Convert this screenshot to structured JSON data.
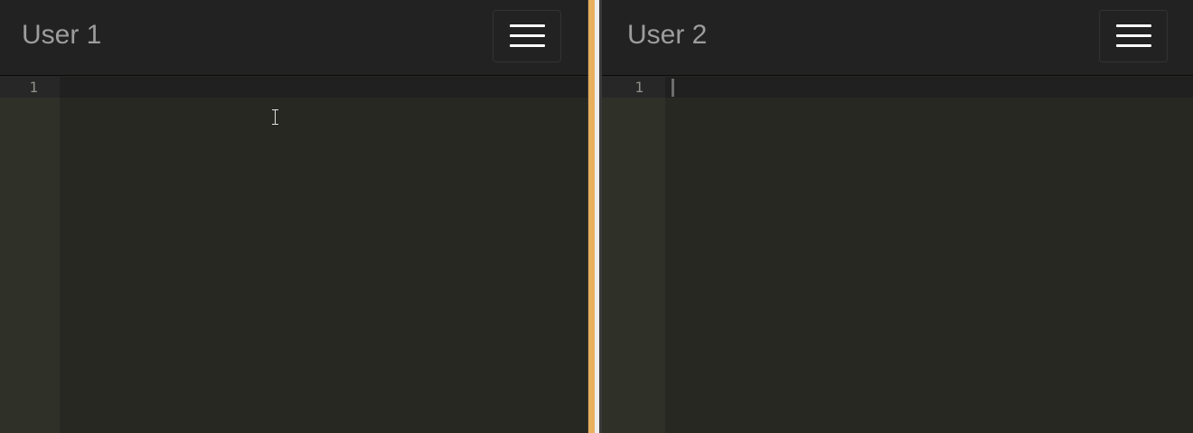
{
  "pane_left": {
    "title": "User 1",
    "editor": {
      "line_numbers": [
        "1"
      ],
      "content": ""
    }
  },
  "pane_right": {
    "title": "User 2",
    "editor": {
      "line_numbers": [
        "1"
      ],
      "content": ""
    }
  },
  "icons": {
    "menu": "hamburger-icon",
    "cursor": "i-beam-cursor-icon"
  },
  "colors": {
    "navbar_bg": "#222222",
    "brand_text": "#9d9d9d",
    "editor_bg": "#272822",
    "gutter_bg": "#2f3129",
    "line_number": "#8f908a",
    "splitter_accent": "#e8b05c"
  }
}
